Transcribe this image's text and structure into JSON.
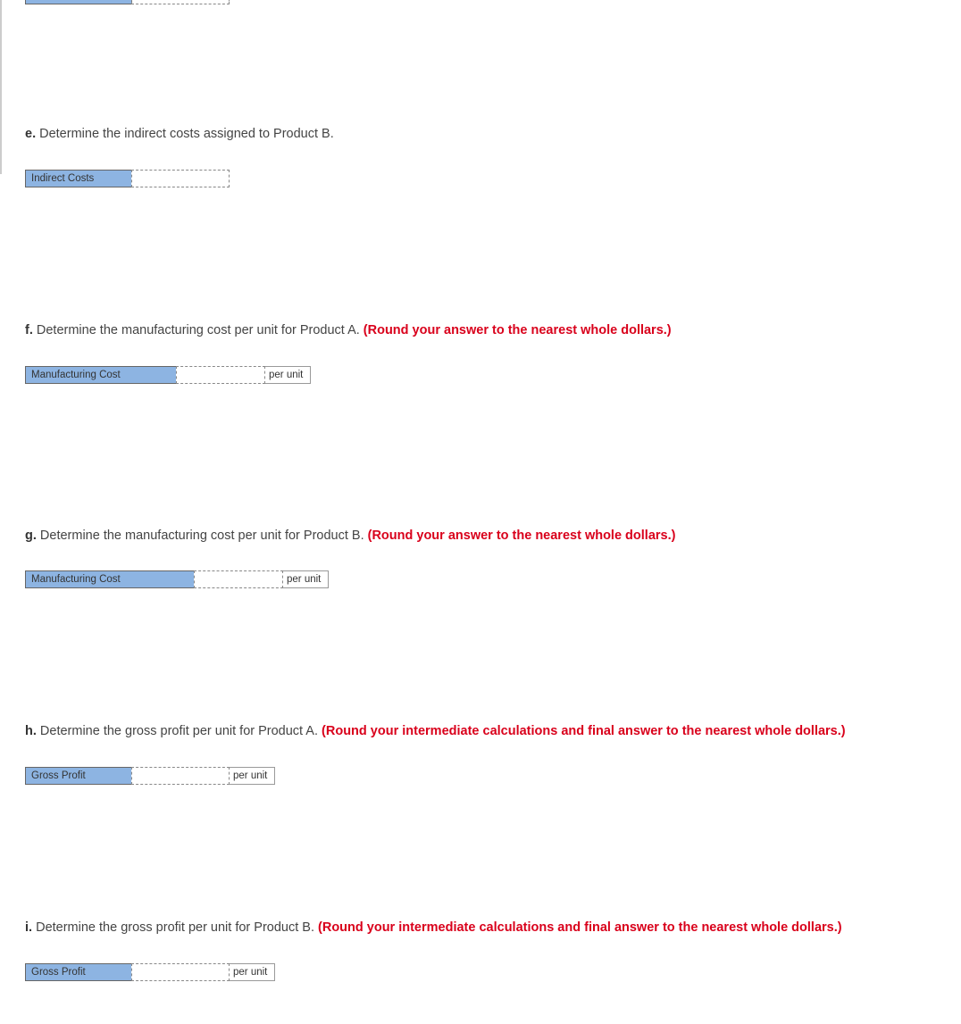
{
  "top_fragment": {
    "label": ""
  },
  "questions": {
    "e": {
      "letter": "e.",
      "text": " Determine the indirect costs assigned to Product B.",
      "label": "Indirect Costs",
      "note": ""
    },
    "f": {
      "letter": "f.",
      "text": " Determine the manufacturing cost per unit for Product A. ",
      "note": "(Round your answer to the nearest whole dollars.)",
      "label": "Manufacturing Cost",
      "unit": "per unit"
    },
    "g": {
      "letter": "g.",
      "text": " Determine the manufacturing cost per unit for Product B. ",
      "note": "(Round your answer to the nearest whole dollars.)",
      "label": "Manufacturing Cost",
      "unit": "per unit"
    },
    "h": {
      "letter": "h.",
      "text": " Determine the gross profit per unit for Product A. ",
      "note": "(Round your intermediate calculations and final answer to the nearest whole dollars.)",
      "label": "Gross Profit",
      "unit": "per unit"
    },
    "i": {
      "letter": "i.",
      "text": " Determine the gross profit per unit for Product B. ",
      "note": "(Round your intermediate calculations and final answer to the nearest whole dollars.)",
      "label": "Gross Profit",
      "unit": "per unit"
    }
  }
}
